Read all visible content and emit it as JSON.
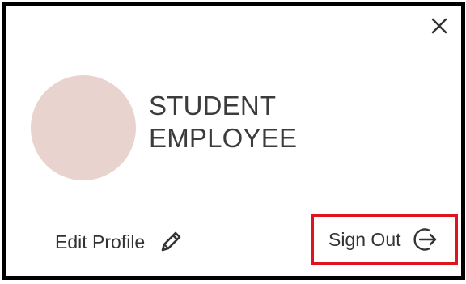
{
  "profile_card": {
    "name_line1": "STUDENT",
    "name_line2": "EMPLOYEE",
    "edit_profile_label": "Edit Profile",
    "sign_out_label": "Sign Out",
    "avatar_color": "#e8d3ce",
    "highlight_color": "#e0141e",
    "icons": {
      "close": "close-icon",
      "edit": "pencil-icon",
      "sign_out": "sign-out-arrow-icon"
    }
  }
}
